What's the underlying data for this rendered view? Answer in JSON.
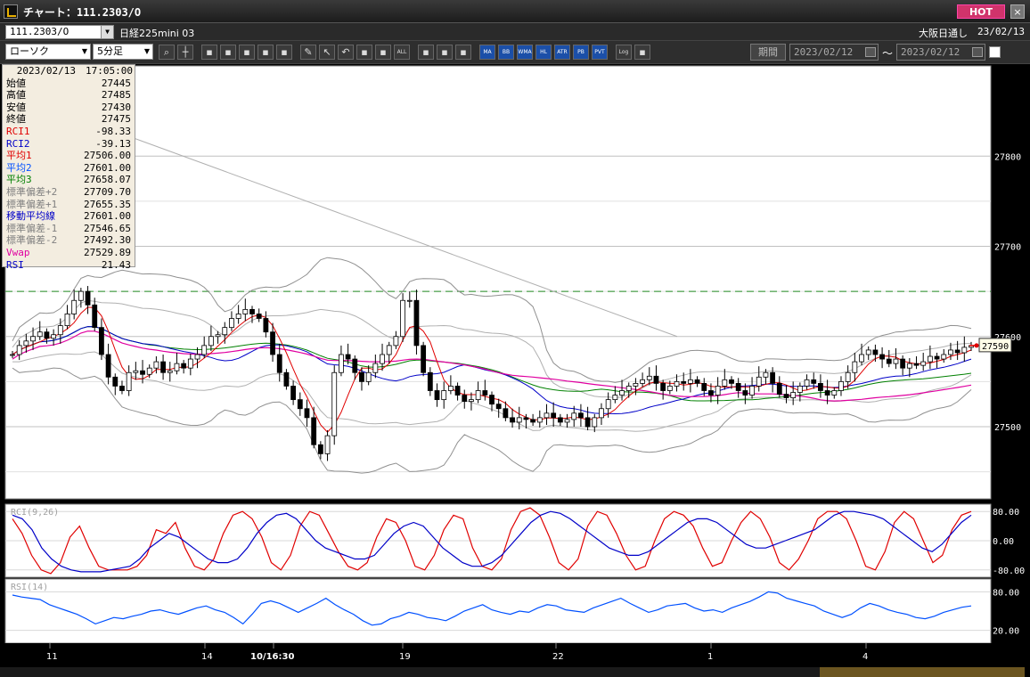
{
  "window": {
    "title": "チャート：111.2303/O",
    "hot_label": "HOT",
    "close_label": "×"
  },
  "instrument": {
    "code": "111.2303/O",
    "name": "日経225mini 03",
    "session": "大阪日通し",
    "date": "23/02/13"
  },
  "toolbar": {
    "chart_type": "ローソク",
    "interval": "5分足",
    "period_label": "期間",
    "date_from": "2023/02/12",
    "date_to": "2023/02/12",
    "range_sep": "～",
    "buttons": [
      "zoom-icon",
      "crosshair-icon",
      "tb1",
      "tb2",
      "tb3",
      "tb4",
      "tb5",
      "pencil-icon",
      "cursor-icon",
      "undo-icon",
      "tb6",
      "tb7",
      "ALL",
      "tb8",
      "tb9",
      "tb10",
      "MA",
      "BB",
      "WMA",
      "HL",
      "ATR",
      "PB",
      "PVT",
      "Log",
      "tb11"
    ]
  },
  "info": {
    "timestamp": "2023/02/13　17:05:00",
    "rows": [
      {
        "k": "始値",
        "v": "27445",
        "color": "#000000"
      },
      {
        "k": "高値",
        "v": "27485",
        "color": "#000000"
      },
      {
        "k": "安値",
        "v": "27430",
        "color": "#000000"
      },
      {
        "k": "終値",
        "v": "27475",
        "color": "#000000"
      },
      {
        "k": "RCI1",
        "v": "-98.33",
        "color": "#e00000"
      },
      {
        "k": "RCI2",
        "v": "-39.13",
        "color": "#0000c8"
      },
      {
        "k": "平均1",
        "v": "27506.00",
        "color": "#e00000"
      },
      {
        "k": "平均2",
        "v": "27601.00",
        "color": "#0050ff"
      },
      {
        "k": "平均3",
        "v": "27658.07",
        "color": "#008000"
      },
      {
        "k": "標準偏差+2",
        "v": "27709.70",
        "color": "#808080"
      },
      {
        "k": "標準偏差+1",
        "v": "27655.35",
        "color": "#808080"
      },
      {
        "k": "移動平均線",
        "v": "27601.00",
        "color": "#0000c8"
      },
      {
        "k": "標準偏差-1",
        "v": "27546.65",
        "color": "#808080"
      },
      {
        "k": "標準偏差-2",
        "v": "27492.30",
        "color": "#808080"
      },
      {
        "k": "Vwap",
        "v": "27529.89",
        "color": "#e000a0"
      },
      {
        "k": "RSI",
        "v": "21.43",
        "color": "#0000c8"
      }
    ]
  },
  "chart_data": [
    {
      "type": "candlestick",
      "y_ticks": [
        "27800",
        "27700",
        "27600",
        "27500"
      ],
      "ylim": [
        27420,
        27900
      ],
      "last_price_tag": "27590",
      "x_ticks": [
        "11",
        "14",
        "10/16:30",
        "19",
        "22",
        "1",
        "4"
      ],
      "dashed_level": 27650,
      "close_series": [
        27580,
        27590,
        27595,
        27600,
        27605,
        27598,
        27602,
        27612,
        27625,
        27640,
        27650,
        27635,
        27610,
        27580,
        27555,
        27545,
        27540,
        27560,
        27562,
        27558,
        27565,
        27572,
        27560,
        27562,
        27570,
        27565,
        27575,
        27580,
        27590,
        27600,
        27602,
        27610,
        27620,
        27625,
        27630,
        27625,
        27620,
        27605,
        27580,
        27560,
        27545,
        27530,
        27520,
        27510,
        27480,
        27470,
        27490,
        27560,
        27580,
        27575,
        27560,
        27550,
        27560,
        27570,
        27580,
        27590,
        27600,
        27640,
        27640,
        27590,
        27560,
        27540,
        27530,
        27540,
        27545,
        27535,
        27528,
        27530,
        27540,
        27535,
        27525,
        27520,
        27510,
        27505,
        27510,
        27508,
        27505,
        27510,
        27515,
        27510,
        27505,
        27508,
        27515,
        27510,
        27500,
        27510,
        27520,
        27530,
        27535,
        27540,
        27545,
        27548,
        27552,
        27556,
        27548,
        27540,
        27545,
        27550,
        27548,
        27552,
        27548,
        27540,
        27535,
        27545,
        27552,
        27548,
        27540,
        27535,
        27545,
        27555,
        27560,
        27548,
        27536,
        27532,
        27538,
        27545,
        27552,
        27548,
        27540,
        27535,
        27540,
        27550,
        27560,
        27572,
        27580,
        27585,
        27580,
        27575,
        27570,
        27575,
        27565,
        27570,
        27568,
        27572,
        27578,
        27575,
        27580,
        27585,
        27582,
        27588,
        27590
      ]
    },
    {
      "type": "line",
      "title": "RCI(9,26)",
      "y_ticks": [
        "80.00",
        "0.00",
        "-80.00"
      ],
      "ylim": [
        -100,
        100
      ],
      "series": [
        {
          "name": "RCI1",
          "color": "#e00000",
          "values": [
            60,
            20,
            -40,
            -80,
            -90,
            -60,
            10,
            40,
            -20,
            -70,
            -80,
            -80,
            -80,
            -70,
            -40,
            30,
            20,
            50,
            -20,
            -70,
            -80,
            -50,
            20,
            70,
            80,
            60,
            10,
            -60,
            -80,
            -40,
            40,
            80,
            70,
            20,
            -30,
            -70,
            -80,
            -60,
            10,
            60,
            50,
            0,
            -70,
            -80,
            -40,
            30,
            70,
            60,
            -20,
            -70,
            -80,
            -50,
            30,
            80,
            90,
            70,
            10,
            -60,
            -80,
            -50,
            40,
            80,
            70,
            20,
            -40,
            -80,
            -70,
            0,
            60,
            80,
            70,
            40,
            -20,
            -70,
            -60,
            0,
            50,
            80,
            60,
            10,
            -60,
            -80,
            -50,
            0,
            60,
            80,
            80,
            60,
            0,
            -70,
            -80,
            -30,
            50,
            80,
            60,
            0,
            -60,
            -40,
            30,
            70,
            80
          ]
        },
        {
          "name": "RCI2",
          "color": "#0000c8",
          "values": [
            70,
            60,
            30,
            -20,
            -50,
            -70,
            -80,
            -85,
            -85,
            -85,
            -80,
            -75,
            -70,
            -50,
            -20,
            0,
            20,
            10,
            -10,
            -30,
            -50,
            -60,
            -60,
            -50,
            -20,
            20,
            50,
            70,
            75,
            60,
            30,
            0,
            -20,
            -30,
            -40,
            -50,
            -50,
            -40,
            -10,
            20,
            40,
            50,
            40,
            10,
            -20,
            -40,
            -60,
            -70,
            -70,
            -60,
            -40,
            -10,
            20,
            50,
            70,
            80,
            75,
            60,
            40,
            20,
            0,
            -20,
            -30,
            -40,
            -40,
            -30,
            -10,
            10,
            30,
            50,
            60,
            60,
            50,
            30,
            10,
            -10,
            -20,
            -20,
            -10,
            0,
            10,
            20,
            30,
            50,
            70,
            80,
            80,
            75,
            70,
            60,
            40,
            20,
            0,
            -20,
            -30,
            -10,
            20,
            50,
            70
          ]
        }
      ]
    },
    {
      "type": "line",
      "title": "RSI(14)",
      "y_ticks": [
        "80.00",
        "20.00"
      ],
      "ylim": [
        0,
        100
      ],
      "series": [
        {
          "name": "RSI",
          "color": "#0050ff",
          "values": [
            75,
            72,
            70,
            68,
            60,
            55,
            50,
            45,
            38,
            30,
            35,
            40,
            38,
            42,
            45,
            50,
            52,
            48,
            45,
            50,
            55,
            58,
            52,
            48,
            40,
            30,
            45,
            62,
            66,
            62,
            55,
            48,
            55,
            62,
            70,
            60,
            52,
            45,
            35,
            28,
            30,
            38,
            42,
            48,
            45,
            40,
            38,
            35,
            42,
            50,
            55,
            60,
            52,
            48,
            45,
            50,
            48,
            55,
            60,
            58,
            52,
            50,
            48,
            55,
            60,
            65,
            70,
            62,
            55,
            48,
            52,
            58,
            60,
            62,
            55,
            50,
            52,
            48,
            55,
            60,
            65,
            72,
            80,
            78,
            70,
            66,
            62,
            58,
            50,
            45,
            40,
            45,
            55,
            62,
            58,
            52,
            48,
            45,
            40,
            38,
            42,
            48,
            52,
            56,
            58
          ]
        }
      ]
    }
  ]
}
